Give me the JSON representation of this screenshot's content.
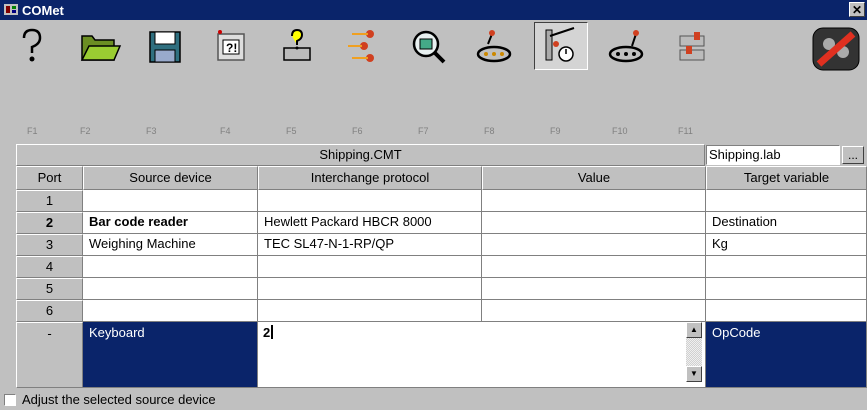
{
  "window": {
    "title": "COMet",
    "close_label": "✕"
  },
  "toolbar": {
    "buttons": [
      {
        "icon": "help-icon",
        "key": "F1"
      },
      {
        "icon": "open-folder-icon",
        "key": "F2"
      },
      {
        "icon": "save-disk-icon",
        "key": "F3"
      },
      {
        "icon": "film-help-icon",
        "key": "F4"
      },
      {
        "icon": "printer-help-icon",
        "key": "F5"
      },
      {
        "icon": "signal-icon",
        "key": "F6"
      },
      {
        "icon": "magnifier-icon",
        "key": "F7"
      },
      {
        "icon": "robot-arm-icon",
        "key": "F8"
      },
      {
        "icon": "gauge-clock-icon",
        "key": "F9",
        "pressed": true
      },
      {
        "icon": "conveyor-icon",
        "key": "F10"
      },
      {
        "icon": "device-adjust-icon",
        "key": "F11"
      },
      {
        "icon": "exit-icon",
        "key": ""
      }
    ]
  },
  "file": {
    "name": "Shipping.CMT",
    "label_file": "Shipping.lab",
    "browse_label": "..."
  },
  "table": {
    "columns": [
      "Port",
      "Source device",
      "Interchange protocol",
      "Value",
      "Target variable"
    ],
    "rows": [
      {
        "port": "1",
        "source": "",
        "protocol": "",
        "value": "",
        "target": ""
      },
      {
        "port": "2",
        "source": "Bar code reader",
        "protocol": "Hewlett Packard HBCR 8000",
        "value": "",
        "target": "Destination"
      },
      {
        "port": "3",
        "source": "Weighing Machine",
        "protocol": "TEC SL47-N-1-RP/QP",
        "value": "",
        "target": "Kg"
      },
      {
        "port": "4",
        "source": "",
        "protocol": "",
        "value": "",
        "target": ""
      },
      {
        "port": "5",
        "source": "",
        "protocol": "",
        "value": "",
        "target": ""
      },
      {
        "port": "6",
        "source": "",
        "protocol": "",
        "value": "",
        "target": ""
      }
    ],
    "edit_row": {
      "port": "-",
      "source": "Keyboard",
      "value": "2",
      "target": "OpCode"
    }
  },
  "status": {
    "checkbox_label": "Adjust the selected source device"
  }
}
